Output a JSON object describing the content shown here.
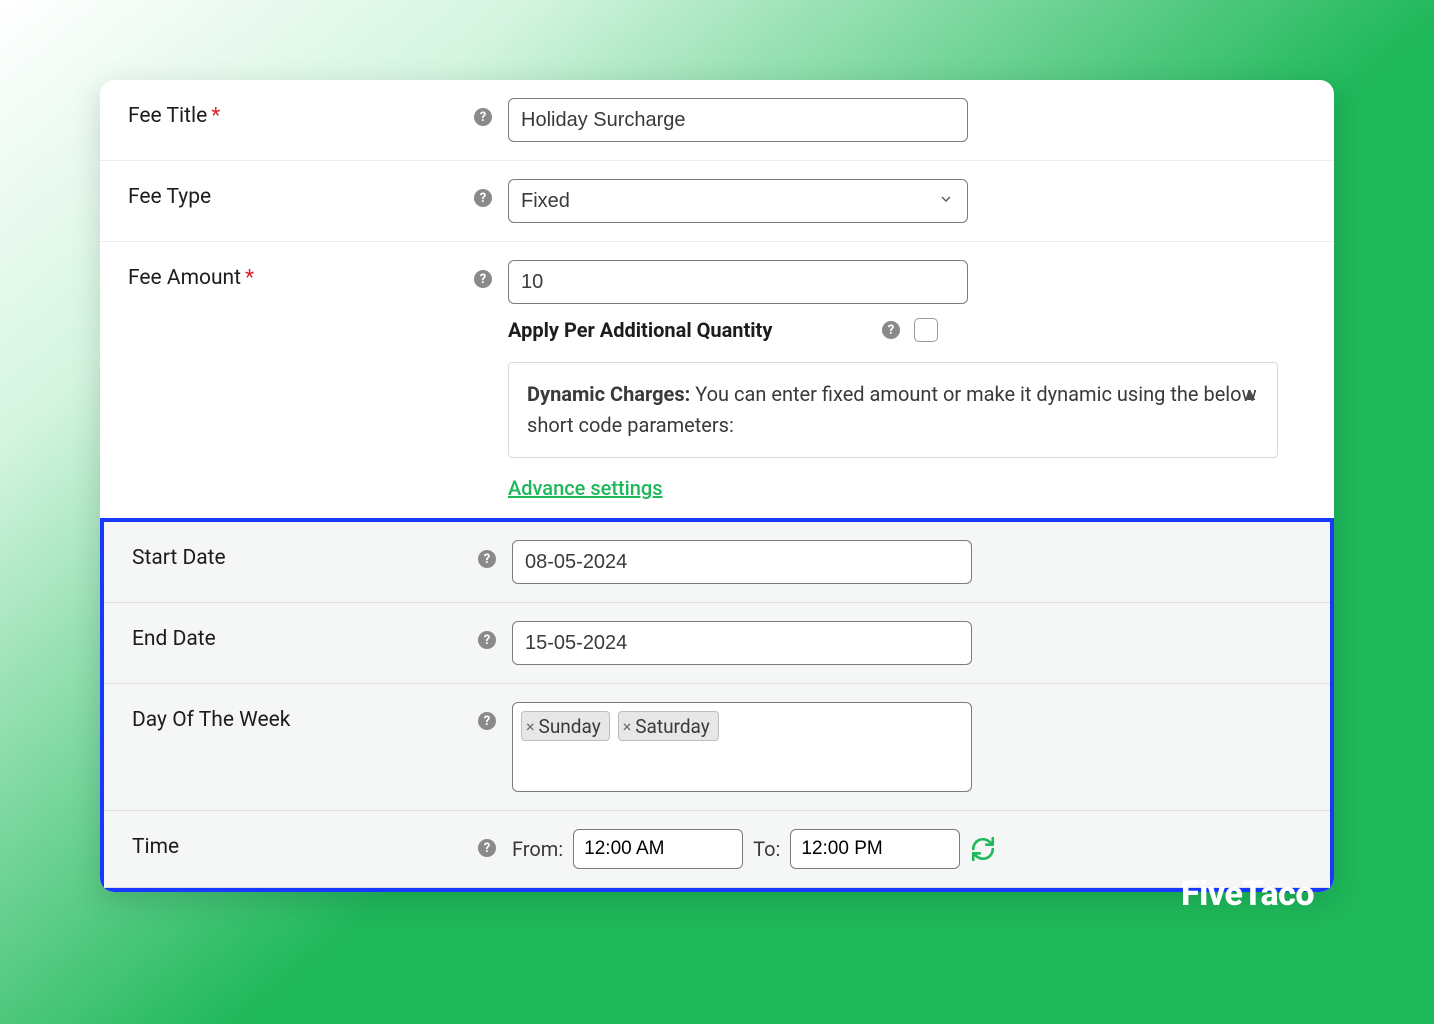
{
  "fee_title": {
    "label": "Fee Title",
    "required": true,
    "value": "Holiday Surcharge"
  },
  "fee_type": {
    "label": "Fee Type",
    "value": "Fixed"
  },
  "fee_amount": {
    "label": "Fee Amount",
    "required": true,
    "value": "10",
    "apply_per_qty_label": "Apply Per Additional Quantity",
    "dynamic_box": {
      "title": "Dynamic Charges:",
      "text": "You can enter fixed amount or make it dynamic using the below short code parameters:"
    },
    "advance_link": "Advance settings"
  },
  "start_date": {
    "label": "Start Date",
    "value": "08-05-2024"
  },
  "end_date": {
    "label": "End Date",
    "value": "15-05-2024"
  },
  "dow": {
    "label": "Day Of The Week",
    "tags": [
      "Sunday",
      "Saturday"
    ]
  },
  "time": {
    "label": "Time",
    "from_label": "From:",
    "to_label": "To:",
    "from": "12:00 AM",
    "to": "12:00 PM"
  },
  "brand": "FiveTaco"
}
